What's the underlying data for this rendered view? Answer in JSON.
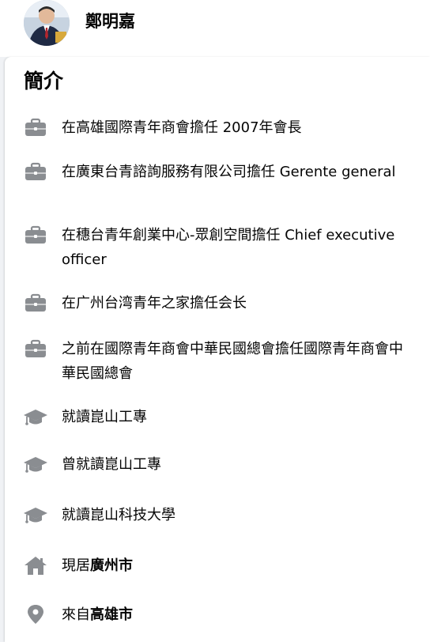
{
  "profile": {
    "name": "鄭明嘉"
  },
  "intro": {
    "title": "簡介",
    "work": [
      "在高雄國際青年商會擔任 2007年會長",
      "在廣東台青諮詢服務有限公司擔任 Gerente general",
      "在穗台青年創業中心-眾創空間擔任 Chief executive officer",
      "在广州台湾青年之家擔任会长",
      "之前在國際青年商會中華民國總會擔任國際青年商會中華民國總會"
    ],
    "education": [
      "就讀崑山工專",
      "曾就讀崑山工專",
      "就讀崑山科技大學"
    ],
    "lives_in": {
      "prefix": "現居",
      "place": "廣州市"
    },
    "from": {
      "prefix": "來自",
      "place": "高雄市"
    }
  },
  "icons": {
    "work": "briefcase-icon",
    "education": "graduation-cap-icon",
    "home": "home-icon",
    "location": "map-pin-icon"
  },
  "colors": {
    "icon": "#8a8d91",
    "text": "#050505",
    "background": "#f0f2f5",
    "card": "#ffffff"
  }
}
